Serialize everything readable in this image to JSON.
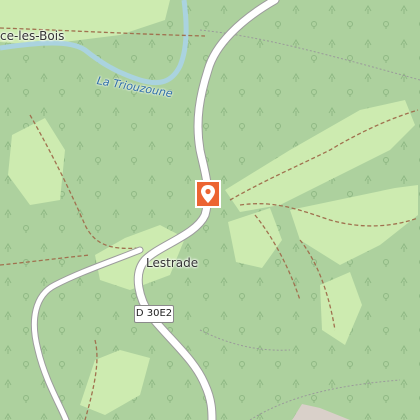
{
  "map": {
    "places": {
      "partial_village": "ce-les-Bois",
      "hamlet": "Lestrade"
    },
    "waterways": {
      "river": "La Triouzoune"
    },
    "roads": {
      "shield": "D 30E2"
    },
    "marker": {
      "icon": "location-pin-icon",
      "color": "#ec6432"
    },
    "colors": {
      "forest": "#add19e",
      "meadow": "#cdebb0",
      "river": "#aad3df",
      "road": "#ffffff",
      "path": "#a0714f"
    }
  }
}
